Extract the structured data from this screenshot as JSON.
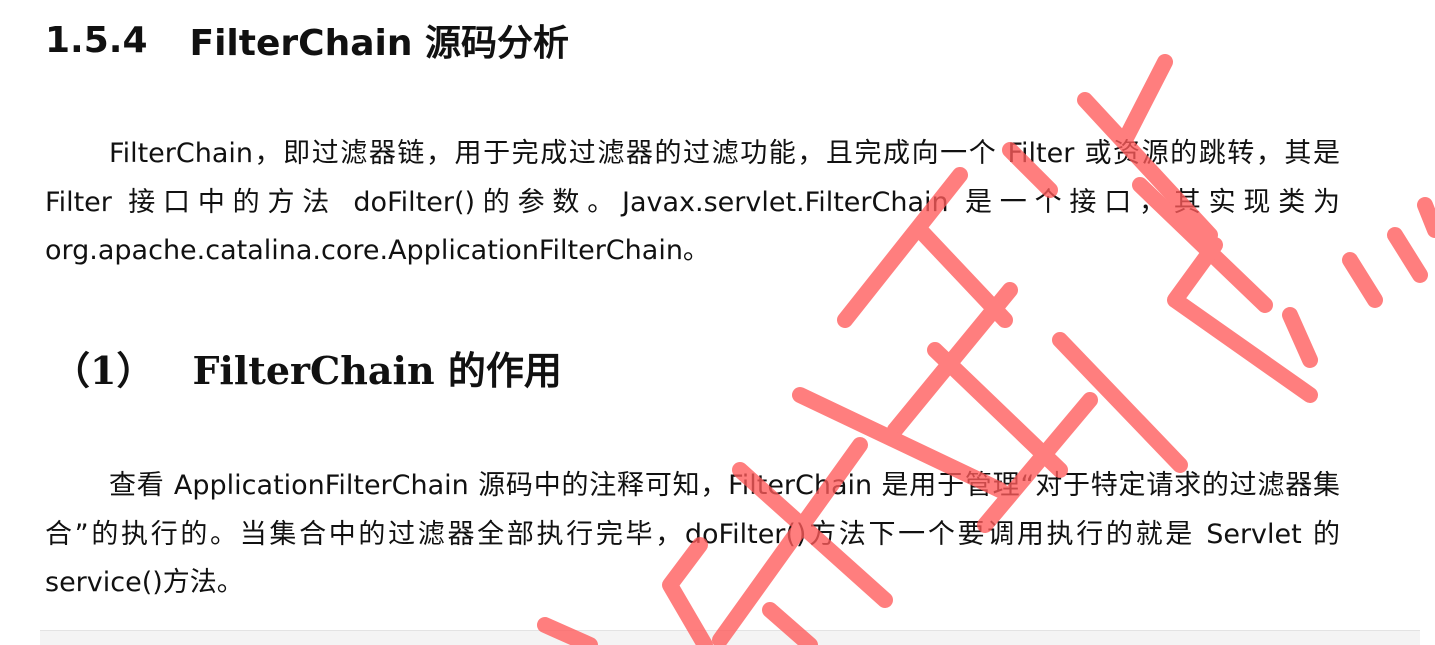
{
  "section": {
    "number": "1.5.4",
    "title": "FilterChain 源码分析"
  },
  "paragraph1": "FilterChain，即过滤器链，用于完成过滤器的过滤功能，且完成向一个 Filter 或资源的跳转，其是 Filter 接口中的方法 doFilter()的参数。Javax.servlet.FilterChain 是一个接口，其实现类为 org.apache.catalina.core.ApplicationFilterChain。",
  "subsection": {
    "number": "（1）",
    "title": "FilterChain 的作用"
  },
  "paragraph2": "查看 ApplicationFilterChain 源码中的注释可知，FilterChain 是用于管理“对于特定请求的过滤器集合”的执行的。当集合中的过滤器全部执行完毕，doFilter()方法下一个要调用执行的就是 Servlet 的 service()方法。",
  "watermark": {
    "text": "动力节点",
    "color": "#ff5a5a"
  }
}
